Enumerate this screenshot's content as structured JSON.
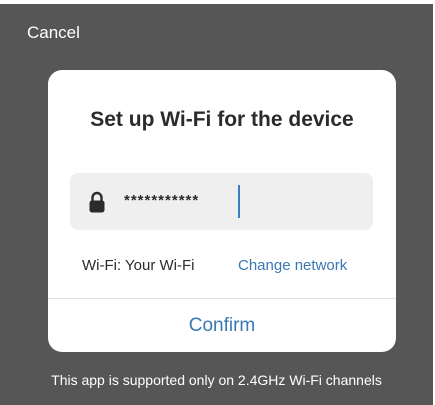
{
  "header": {
    "cancel_label": "Cancel"
  },
  "dialog": {
    "title": "Set up Wi-Fi for the device",
    "password_field": {
      "value": "***********",
      "icon": "lock-icon"
    },
    "wifi_label": "Wi-Fi: Your Wi-Fi",
    "change_network_label": "Change network",
    "confirm_label": "Confirm"
  },
  "footer": {
    "note": "This app is supported only on 2.4GHz Wi-Fi channels"
  },
  "colors": {
    "backdrop": "#565656",
    "accent": "#3a78b5",
    "field_bg": "#efefef",
    "text": "#2b2b2b"
  }
}
